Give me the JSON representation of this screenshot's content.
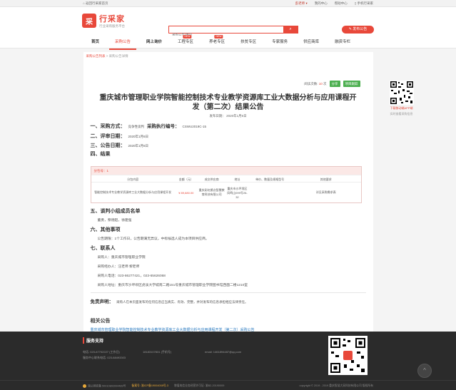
{
  "topbar": {
    "back_home": "返回行采家首页",
    "user": "彭老师",
    "my_center": "我的中心",
    "help_center": "帮助中心",
    "mobile": "手机行采家"
  },
  "header": {
    "logo_mark": "采",
    "logo_name": "行采家",
    "logo_slogan": "行业采购服务平台",
    "search_placeholder": "采购公告/供应",
    "publish_button": "发布公告"
  },
  "nav": {
    "items": [
      {
        "label": "首页",
        "bold": true
      },
      {
        "label": "采购公告",
        "active": true
      },
      {
        "label": "网上询价",
        "bold": true
      },
      {
        "label": "工程专区",
        "hot": "NEW"
      },
      {
        "label": "养老专区",
        "hot": "NEW"
      },
      {
        "label": "扶贫专区"
      },
      {
        "label": "专家服务"
      },
      {
        "label": "供应商库"
      },
      {
        "label": "融资专栏"
      }
    ]
  },
  "breadcrumb": {
    "first": "采购公告列表",
    "sep": " > ",
    "second": "采购公告详情"
  },
  "stats": {
    "views_label": "阅读次数:",
    "views_value": "10",
    "views_unit": "次",
    "share": "分享",
    "track_button": "项目跟踪"
  },
  "qr_side": {
    "cap1": "下载移动端APP端",
    "cap2": "实时查看采购信息"
  },
  "notice": {
    "title": "重庆城市管理职业学院智能控制技术专业教学资源库工业大数据分析与应用课程开发（第二次）结果公告",
    "pub_date": "发布日期： 2020年1月6日",
    "sections": {
      "s1_label": "一、采购方式：",
      "s1_method": "竞争性谈判",
      "s1_no_label": "采购执行编号：",
      "s1_no": "CSWU2019C-15",
      "s2_label": "二、评审日期：",
      "s2_value": "2020年1月6日",
      "s3_label": "三、公告日期：",
      "s3_value": "2020年1月6日",
      "s4_label": "四、结果",
      "s5_label": "五、谈判小组成员名单",
      "s5_value": "董勇，祭德超，徐建强",
      "s6_label": "六、其他事项",
      "s6_value": "公告期限：1个工作日，公告期满无异议，中标候选人成为本项目供应商。",
      "s7_label": "七、联系人",
      "contact_unit": "采购人：重庆城市管理职业学院",
      "contact_person": "采购经办人：汪老师 黎老师",
      "contact_phone": "采购人电话：023-86277421，023-65626068",
      "contact_addr": "采购人地址：重庆市沙坪坝区虎溪大学城南二路151号重庆城市管理职业学院图书馆西面二楼1210室"
    },
    "table": {
      "package": "分包号：1",
      "headers": [
        "分包内容",
        "金额（元）",
        "成交供应商",
        "地址",
        "单价、数量及规格型号",
        "其他要求"
      ],
      "rows": [
        {
          "content": "智能控制技术专业教学资源库工业大数据分析与应用课程开发",
          "amount": "¥ 89,680.00",
          "supplier": "重庆彩虹鹊点智慧教育科技有限公司",
          "address": "重庆市沙坪坝区凤鸣山099号26-32",
          "spec": "",
          "other": "详见采购需求表"
        }
      ]
    },
    "disclaimer_label": "免责声明：",
    "disclaimer_text": "采购人在本页面发布的任何信息应当真实、有效、完整，并对发布的信息承担相应法律责任。"
  },
  "related": {
    "heading": "相关公告",
    "link": "重庆城市管理职业学院智能控制技术专业教学资源库工业大数据分析与应用课程开发（第二次）采购公告"
  },
  "footer": {
    "heading": "服务支持",
    "phone1": "电话: 023-67702227 (工作日)",
    "phone2": "18183107831 (手机号)",
    "email": "email: 1461894487@qq.com",
    "service": "服务中心联系电话: 023-68493303",
    "to_top": "^",
    "bottom_items": [
      "渝公网安备 50010802004489号",
      "备案号: 渝ICP备19004008号-3",
      "增值电信业务经营许可证: 渝B2-20190009"
    ],
    "copyright": "copyright © 2019 - 2019 重庆智慧大采科技有限公司 版权所有"
  }
}
